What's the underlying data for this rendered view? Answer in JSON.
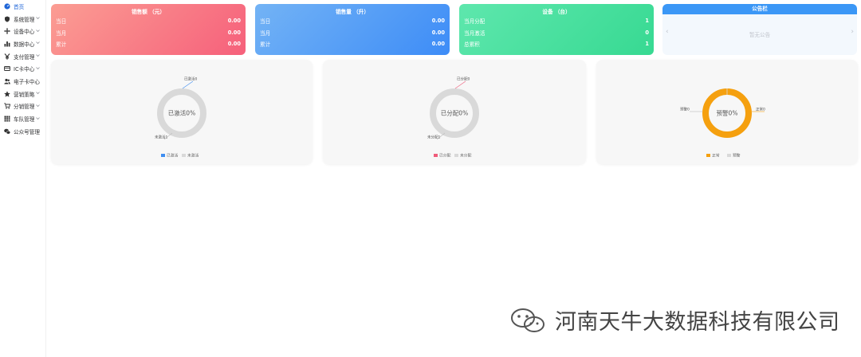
{
  "sidebar": {
    "items": [
      {
        "label": "首页",
        "icon": "dashboard-icon",
        "has_children": false,
        "active": true
      },
      {
        "label": "系统管理",
        "icon": "shield-icon",
        "has_children": true,
        "active": false
      },
      {
        "label": "设备中心",
        "icon": "move-icon",
        "has_children": true,
        "active": false
      },
      {
        "label": "数据中心",
        "icon": "bar-chart-icon",
        "has_children": true,
        "active": false
      },
      {
        "label": "支付管理",
        "icon": "yen-icon",
        "has_children": true,
        "active": false
      },
      {
        "label": "IC卡中心",
        "icon": "card-icon",
        "has_children": true,
        "active": false
      },
      {
        "label": "电子卡中心",
        "icon": "users-icon",
        "has_children": false,
        "active": false
      },
      {
        "label": "营销策略",
        "icon": "star-icon",
        "has_children": true,
        "active": false
      },
      {
        "label": "分销管理",
        "icon": "cart-icon",
        "has_children": true,
        "active": false
      },
      {
        "label": "车队管理",
        "icon": "grid-icon",
        "has_children": true,
        "active": false
      },
      {
        "label": "公众号管理",
        "icon": "wechat-icon",
        "has_children": false,
        "active": false
      }
    ]
  },
  "cards": {
    "sales_amount": {
      "title": "销售额 （元）",
      "rows": [
        {
          "label": "当日",
          "value": "0.00"
        },
        {
          "label": "当月",
          "value": "0.00"
        },
        {
          "label": "累计",
          "value": "0.00"
        }
      ]
    },
    "sales_volume": {
      "title": "销售量 （升）",
      "rows": [
        {
          "label": "当日",
          "value": "0.00"
        },
        {
          "label": "当月",
          "value": "0.00"
        },
        {
          "label": "累计",
          "value": "0.00"
        }
      ]
    },
    "devices": {
      "title": "设备 （台）",
      "rows": [
        {
          "label": "当月分配",
          "value": "1"
        },
        {
          "label": "当月激活",
          "value": "0"
        },
        {
          "label": "总累积",
          "value": "1"
        }
      ]
    }
  },
  "notice": {
    "title": "公告栏",
    "empty_text": "暂无公告",
    "prev_glyph": "‹",
    "next_glyph": "›"
  },
  "chart_data": [
    {
      "type": "pie",
      "center_label": "已激活0%",
      "slices": [
        {
          "name": "已激活",
          "value": 0,
          "color": "#3f8ef1",
          "label": "已激活0"
        },
        {
          "name": "未激活",
          "value": 1,
          "color": "#d9d9d9",
          "label": "未激活1"
        }
      ],
      "legend": [
        "已激活",
        "未激活"
      ],
      "legend_position": "bottom-center"
    },
    {
      "type": "pie",
      "center_label": "已分配0%",
      "slices": [
        {
          "name": "已分配",
          "value": 0,
          "color": "#ef5c7a",
          "label": "已分配0"
        },
        {
          "name": "未分配",
          "value": 1,
          "color": "#d9d9d9",
          "label": "未分配1"
        }
      ],
      "legend": [
        "已分配",
        "未分配"
      ],
      "legend_position": "bottom-center"
    },
    {
      "type": "pie",
      "center_label": "预警0%",
      "slices": [
        {
          "name": "正常",
          "value": 1,
          "color": "#f5a00f",
          "label": "正常0"
        },
        {
          "name": "预警",
          "value": 0,
          "color": "#d9d9d9",
          "label": "预警0"
        }
      ],
      "legend": [
        "正常",
        "预警"
      ],
      "legend_position": "bottom-center"
    }
  ],
  "watermark": {
    "text": "河南天牛大数据科技有限公司"
  },
  "colors": {
    "accent": "#1f66d8",
    "notice_header": "#3b97f6"
  }
}
